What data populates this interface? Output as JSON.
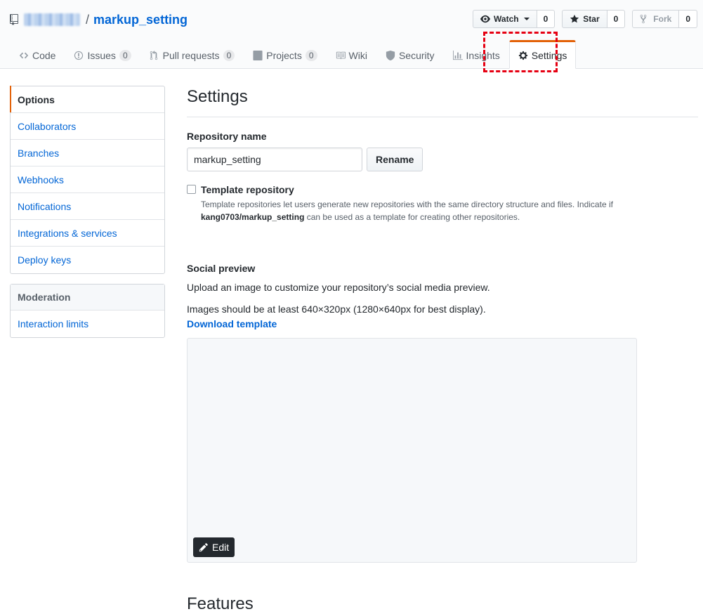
{
  "repo": {
    "separator": "/",
    "name": "markup_setting"
  },
  "actions": {
    "watch": {
      "label": "Watch",
      "count": "0"
    },
    "star": {
      "label": "Star",
      "count": "0"
    },
    "fork": {
      "label": "Fork",
      "count": "0"
    }
  },
  "tabs": [
    {
      "label": "Code",
      "icon": "code-icon"
    },
    {
      "label": "Issues",
      "count": "0",
      "icon": "issue-opened-icon"
    },
    {
      "label": "Pull requests",
      "count": "0",
      "icon": "git-pull-request-icon"
    },
    {
      "label": "Projects",
      "count": "0",
      "icon": "project-icon"
    },
    {
      "label": "Wiki",
      "icon": "book-icon"
    },
    {
      "label": "Security",
      "icon": "shield-icon"
    },
    {
      "label": "Insights",
      "icon": "graph-icon"
    },
    {
      "label": "Settings",
      "icon": "gear-icon",
      "selected": true
    }
  ],
  "highlight_color": "#e60012",
  "accent_color": "#e36209",
  "link_color": "#0366d6",
  "sidebar": {
    "items": [
      {
        "label": "Options",
        "selected": true
      },
      {
        "label": "Collaborators"
      },
      {
        "label": "Branches"
      },
      {
        "label": "Webhooks"
      },
      {
        "label": "Notifications"
      },
      {
        "label": "Integrations & services"
      },
      {
        "label": "Deploy keys"
      }
    ],
    "moderation": {
      "heading": "Moderation",
      "items": [
        {
          "label": "Interaction limits"
        }
      ]
    }
  },
  "main": {
    "title": "Settings",
    "repository_name_label": "Repository name",
    "repository_name_value": "markup_setting",
    "rename_label": "Rename",
    "template": {
      "label": "Template repository",
      "note_before": "Template repositories let users generate new repositories with the same directory structure and files. Indicate if",
      "note_repo": "kang0703/markup_setting",
      "note_after": "can be used as a template for creating other repositories.",
      "checked": false
    },
    "social": {
      "heading": "Social preview",
      "desc": "Upload an image to customize your repository’s social media preview.",
      "size_note": "Images should be at least 640×320px (1280×640px for best display).",
      "download_label": "Download template",
      "edit_label": "Edit"
    },
    "next_heading": "Features"
  }
}
